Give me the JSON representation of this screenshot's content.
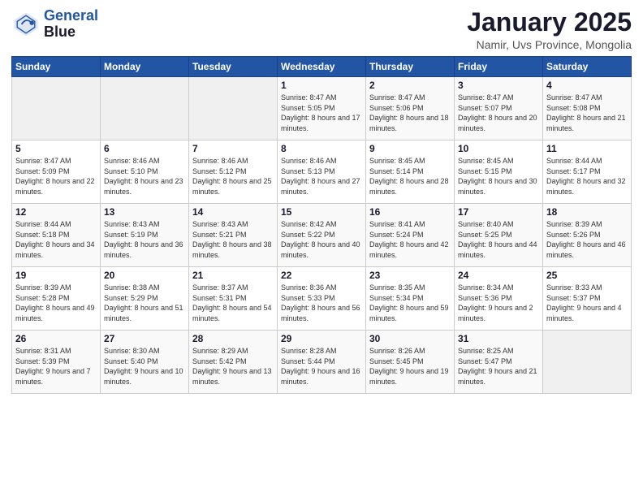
{
  "header": {
    "logo_line1": "General",
    "logo_line2": "Blue",
    "month_title": "January 2025",
    "subtitle": "Namir, Uvs Province, Mongolia"
  },
  "weekdays": [
    "Sunday",
    "Monday",
    "Tuesday",
    "Wednesday",
    "Thursday",
    "Friday",
    "Saturday"
  ],
  "weeks": [
    [
      {
        "day": "",
        "sunrise": "",
        "sunset": "",
        "daylight": ""
      },
      {
        "day": "",
        "sunrise": "",
        "sunset": "",
        "daylight": ""
      },
      {
        "day": "",
        "sunrise": "",
        "sunset": "",
        "daylight": ""
      },
      {
        "day": "1",
        "sunrise": "Sunrise: 8:47 AM",
        "sunset": "Sunset: 5:05 PM",
        "daylight": "Daylight: 8 hours and 17 minutes."
      },
      {
        "day": "2",
        "sunrise": "Sunrise: 8:47 AM",
        "sunset": "Sunset: 5:06 PM",
        "daylight": "Daylight: 8 hours and 18 minutes."
      },
      {
        "day": "3",
        "sunrise": "Sunrise: 8:47 AM",
        "sunset": "Sunset: 5:07 PM",
        "daylight": "Daylight: 8 hours and 20 minutes."
      },
      {
        "day": "4",
        "sunrise": "Sunrise: 8:47 AM",
        "sunset": "Sunset: 5:08 PM",
        "daylight": "Daylight: 8 hours and 21 minutes."
      }
    ],
    [
      {
        "day": "5",
        "sunrise": "Sunrise: 8:47 AM",
        "sunset": "Sunset: 5:09 PM",
        "daylight": "Daylight: 8 hours and 22 minutes."
      },
      {
        "day": "6",
        "sunrise": "Sunrise: 8:46 AM",
        "sunset": "Sunset: 5:10 PM",
        "daylight": "Daylight: 8 hours and 23 minutes."
      },
      {
        "day": "7",
        "sunrise": "Sunrise: 8:46 AM",
        "sunset": "Sunset: 5:12 PM",
        "daylight": "Daylight: 8 hours and 25 minutes."
      },
      {
        "day": "8",
        "sunrise": "Sunrise: 8:46 AM",
        "sunset": "Sunset: 5:13 PM",
        "daylight": "Daylight: 8 hours and 27 minutes."
      },
      {
        "day": "9",
        "sunrise": "Sunrise: 8:45 AM",
        "sunset": "Sunset: 5:14 PM",
        "daylight": "Daylight: 8 hours and 28 minutes."
      },
      {
        "day": "10",
        "sunrise": "Sunrise: 8:45 AM",
        "sunset": "Sunset: 5:15 PM",
        "daylight": "Daylight: 8 hours and 30 minutes."
      },
      {
        "day": "11",
        "sunrise": "Sunrise: 8:44 AM",
        "sunset": "Sunset: 5:17 PM",
        "daylight": "Daylight: 8 hours and 32 minutes."
      }
    ],
    [
      {
        "day": "12",
        "sunrise": "Sunrise: 8:44 AM",
        "sunset": "Sunset: 5:18 PM",
        "daylight": "Daylight: 8 hours and 34 minutes."
      },
      {
        "day": "13",
        "sunrise": "Sunrise: 8:43 AM",
        "sunset": "Sunset: 5:19 PM",
        "daylight": "Daylight: 8 hours and 36 minutes."
      },
      {
        "day": "14",
        "sunrise": "Sunrise: 8:43 AM",
        "sunset": "Sunset: 5:21 PM",
        "daylight": "Daylight: 8 hours and 38 minutes."
      },
      {
        "day": "15",
        "sunrise": "Sunrise: 8:42 AM",
        "sunset": "Sunset: 5:22 PM",
        "daylight": "Daylight: 8 hours and 40 minutes."
      },
      {
        "day": "16",
        "sunrise": "Sunrise: 8:41 AM",
        "sunset": "Sunset: 5:24 PM",
        "daylight": "Daylight: 8 hours and 42 minutes."
      },
      {
        "day": "17",
        "sunrise": "Sunrise: 8:40 AM",
        "sunset": "Sunset: 5:25 PM",
        "daylight": "Daylight: 8 hours and 44 minutes."
      },
      {
        "day": "18",
        "sunrise": "Sunrise: 8:39 AM",
        "sunset": "Sunset: 5:26 PM",
        "daylight": "Daylight: 8 hours and 46 minutes."
      }
    ],
    [
      {
        "day": "19",
        "sunrise": "Sunrise: 8:39 AM",
        "sunset": "Sunset: 5:28 PM",
        "daylight": "Daylight: 8 hours and 49 minutes."
      },
      {
        "day": "20",
        "sunrise": "Sunrise: 8:38 AM",
        "sunset": "Sunset: 5:29 PM",
        "daylight": "Daylight: 8 hours and 51 minutes."
      },
      {
        "day": "21",
        "sunrise": "Sunrise: 8:37 AM",
        "sunset": "Sunset: 5:31 PM",
        "daylight": "Daylight: 8 hours and 54 minutes."
      },
      {
        "day": "22",
        "sunrise": "Sunrise: 8:36 AM",
        "sunset": "Sunset: 5:33 PM",
        "daylight": "Daylight: 8 hours and 56 minutes."
      },
      {
        "day": "23",
        "sunrise": "Sunrise: 8:35 AM",
        "sunset": "Sunset: 5:34 PM",
        "daylight": "Daylight: 8 hours and 59 minutes."
      },
      {
        "day": "24",
        "sunrise": "Sunrise: 8:34 AM",
        "sunset": "Sunset: 5:36 PM",
        "daylight": "Daylight: 9 hours and 2 minutes."
      },
      {
        "day": "25",
        "sunrise": "Sunrise: 8:33 AM",
        "sunset": "Sunset: 5:37 PM",
        "daylight": "Daylight: 9 hours and 4 minutes."
      }
    ],
    [
      {
        "day": "26",
        "sunrise": "Sunrise: 8:31 AM",
        "sunset": "Sunset: 5:39 PM",
        "daylight": "Daylight: 9 hours and 7 minutes."
      },
      {
        "day": "27",
        "sunrise": "Sunrise: 8:30 AM",
        "sunset": "Sunset: 5:40 PM",
        "daylight": "Daylight: 9 hours and 10 minutes."
      },
      {
        "day": "28",
        "sunrise": "Sunrise: 8:29 AM",
        "sunset": "Sunset: 5:42 PM",
        "daylight": "Daylight: 9 hours and 13 minutes."
      },
      {
        "day": "29",
        "sunrise": "Sunrise: 8:28 AM",
        "sunset": "Sunset: 5:44 PM",
        "daylight": "Daylight: 9 hours and 16 minutes."
      },
      {
        "day": "30",
        "sunrise": "Sunrise: 8:26 AM",
        "sunset": "Sunset: 5:45 PM",
        "daylight": "Daylight: 9 hours and 19 minutes."
      },
      {
        "day": "31",
        "sunrise": "Sunrise: 8:25 AM",
        "sunset": "Sunset: 5:47 PM",
        "daylight": "Daylight: 9 hours and 21 minutes."
      },
      {
        "day": "",
        "sunrise": "",
        "sunset": "",
        "daylight": ""
      }
    ]
  ]
}
